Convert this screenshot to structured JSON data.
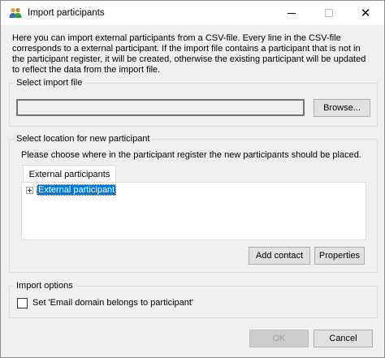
{
  "window": {
    "title": "Import participants"
  },
  "description": "Here you can import external participants from a CSV-file. Every line in the CSV-file corresponds to a external participant. If the import file contains a participant that is not in the participant register, it will be created, otherwise the existing participant will be updated to reflect the data from the import file.",
  "import_file": {
    "group_label": "Select import file",
    "path_value": "",
    "browse_label": "Browse..."
  },
  "location": {
    "group_label": "Select location for new participant",
    "hint": "Please choose where in the participant register the new participants should be placed.",
    "tab_label": "External participants",
    "tree": [
      {
        "label": "External participant",
        "selected": true,
        "expandable": true
      }
    ],
    "add_contact_label": "Add contact",
    "properties_label": "Properties"
  },
  "options": {
    "group_label": "Import options",
    "email_domain_checkbox_label": "Set 'Email domain belongs to participant'",
    "email_domain_checked": false
  },
  "footer": {
    "ok_label": "OK",
    "cancel_label": "Cancel",
    "ok_enabled": false
  },
  "colors": {
    "selection": "#0078d7",
    "focus_border": "#3c7fb1",
    "dialog_bg": "#f0f0f0"
  }
}
